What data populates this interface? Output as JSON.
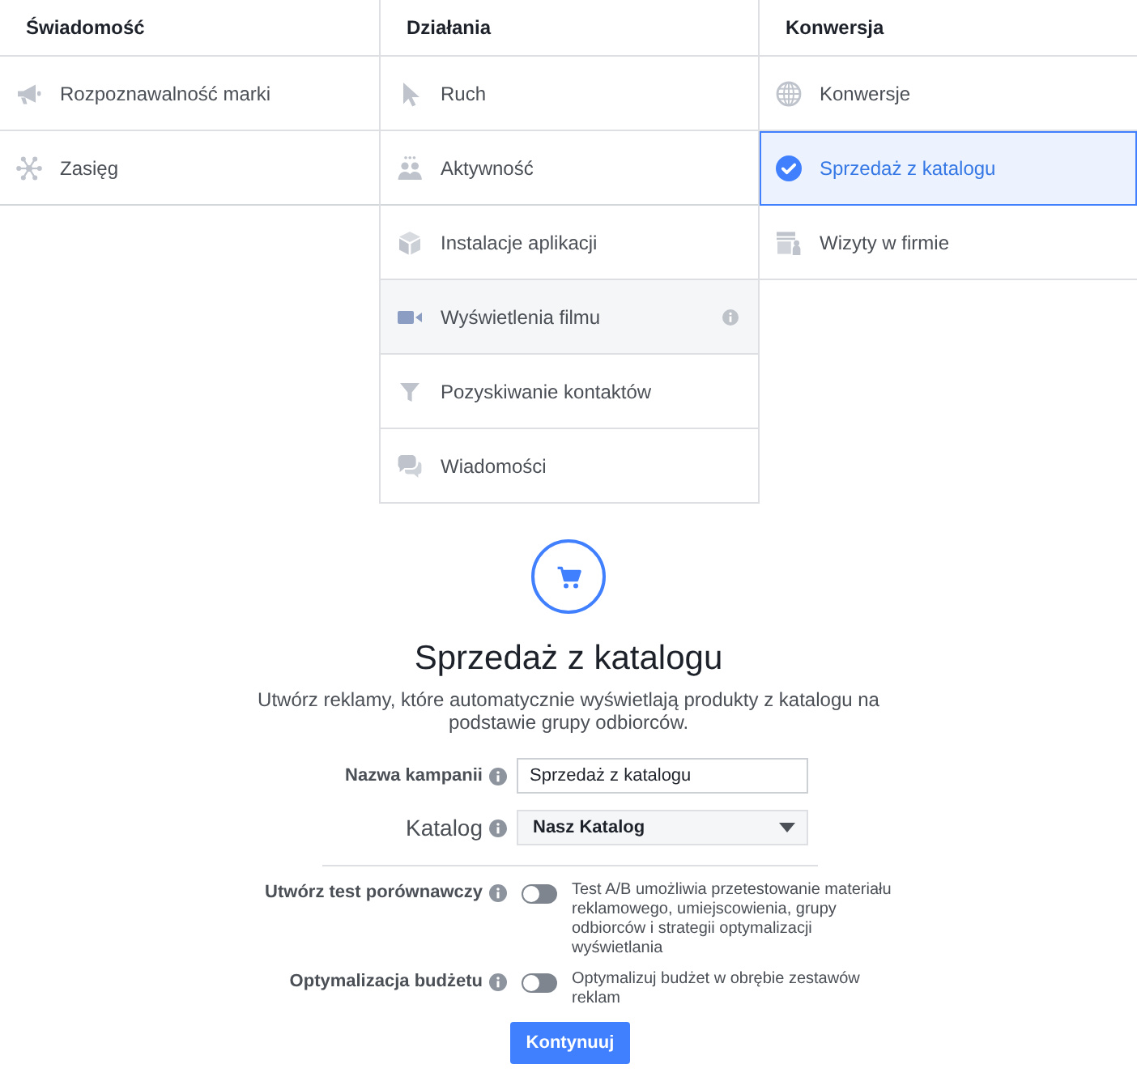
{
  "columns": [
    {
      "heading": "Świadomość",
      "items": [
        {
          "label": "Rozpoznawalność marki",
          "selected": false,
          "hovered": false,
          "info": false
        },
        {
          "label": "Zasięg",
          "selected": false,
          "hovered": false,
          "info": false
        }
      ]
    },
    {
      "heading": "Działania",
      "items": [
        {
          "label": "Ruch",
          "selected": false,
          "hovered": false,
          "info": false
        },
        {
          "label": "Aktywność",
          "selected": false,
          "hovered": false,
          "info": false
        },
        {
          "label": "Instalacje aplikacji",
          "selected": false,
          "hovered": false,
          "info": false
        },
        {
          "label": "Wyświetlenia filmu",
          "selected": false,
          "hovered": true,
          "info": true
        },
        {
          "label": "Pozyskiwanie kontaktów",
          "selected": false,
          "hovered": false,
          "info": false
        },
        {
          "label": "Wiadomości",
          "selected": false,
          "hovered": false,
          "info": false
        }
      ]
    },
    {
      "heading": "Konwersja",
      "items": [
        {
          "label": "Konwersje",
          "selected": false,
          "hovered": false,
          "info": false
        },
        {
          "label": "Sprzedaż z katalogu",
          "selected": true,
          "hovered": false,
          "info": false
        },
        {
          "label": "Wizyty w firmie",
          "selected": false,
          "hovered": false,
          "info": false
        }
      ]
    }
  ],
  "objective": {
    "title": "Sprzedaż z katalogu",
    "description": "Utwórz reklamy, które automatycznie wyświetlają produkty z katalogu na podstawie grupy odbiorców."
  },
  "form": {
    "fields": [
      {
        "kind": "text",
        "label": "Nazwa kampanii",
        "value": "Sprzedaż z katalogu"
      },
      {
        "kind": "dropdown",
        "label": "Katalog",
        "value": "Nasz Katalog"
      }
    ],
    "toggles": [
      {
        "label": "Utwórz test porównawczy",
        "on": false,
        "description": "Test A/B umożliwia przetestowanie materiału reklamowego, umiejscowienia, grupy odbiorców i strategii optymalizacji wyświetlania"
      },
      {
        "label": "Optymalizacja budżetu",
        "on": false,
        "description": "Optymalizuj budżet w obrębie zestawów reklam"
      }
    ],
    "continue_button": "Kontynuuj"
  }
}
